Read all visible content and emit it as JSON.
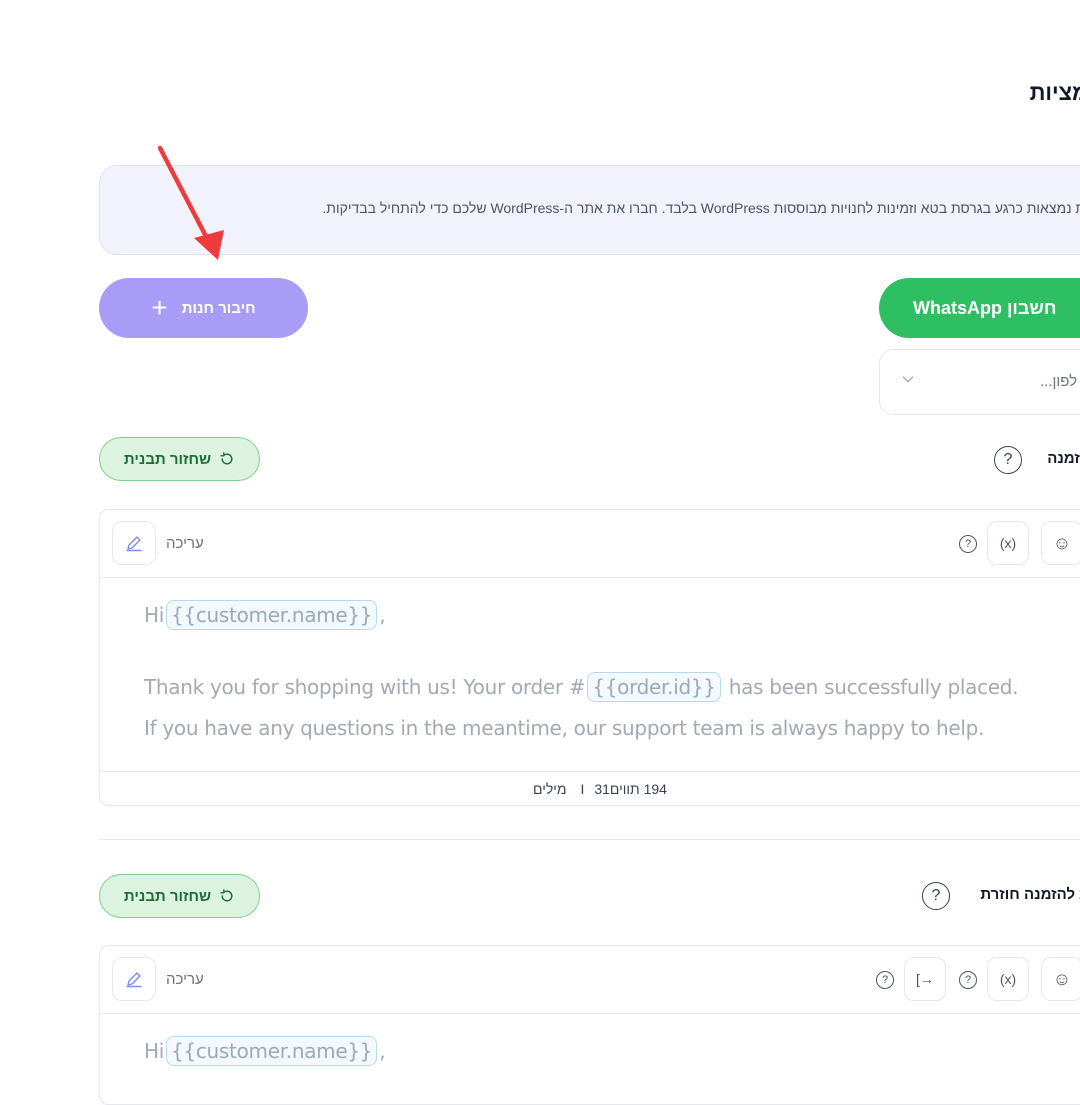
{
  "page": {
    "title": "מציות"
  },
  "banner": {
    "text": "ציות נמצאות כרגע בגרסת בטא וזמינות לחנויות מבוססות WordPress בלבד. חברו את אתר ה-WordPress שלכם כדי להתחיל בבדיקות."
  },
  "actions": {
    "connect_store": "חיבור חנות",
    "whatsapp_account": "WhatsApp חשבון"
  },
  "phone_select": {
    "value": "לפון..."
  },
  "sections": [
    {
      "label": "הזמנה",
      "reset_label": "שחזור תבנית",
      "edit_label": "עריכה",
      "lines": {
        "greeting_prefix": "Hi",
        "greeting_var": "{{customer.name}}",
        "greeting_suffix": ",",
        "line2_prefix": "Thank you for shopping with us! Your order #",
        "line2_var": "{{order.id}}",
        "line2_suffix": "has been successfully placed.",
        "line3": "If you have any questions in the meantime, our support team is always happy to help."
      },
      "counter": {
        "chars": "194 תווים",
        "separator": "I",
        "words": "31 מילים"
      }
    },
    {
      "label": "ת להזמנה חוזרת",
      "reset_label": "שחזור תבנית",
      "edit_label": "עריכה",
      "lines": {
        "greeting_prefix": "Hi",
        "greeting_var": "{{customer.name}}",
        "greeting_suffix": ","
      }
    }
  ],
  "toolbar": {
    "variable_symbol": "(x)",
    "help_symbol": "?",
    "emoji_symbol": "☺",
    "insert_symbol": "[→"
  },
  "colors": {
    "primary_purple": "#a89cf7",
    "whatsapp_green": "#2fbf63",
    "reset_green_bg": "#dcf3df",
    "arrow_red": "#ef3b3b"
  }
}
